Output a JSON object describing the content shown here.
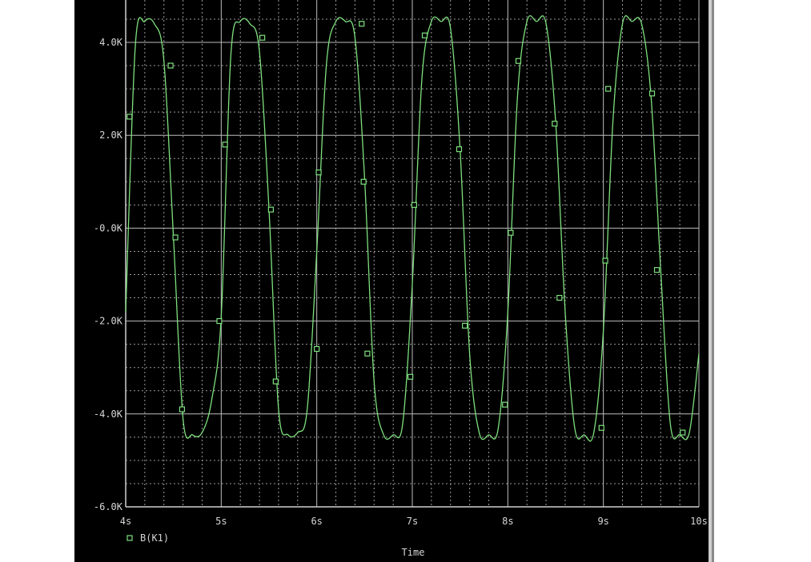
{
  "chart_data": {
    "type": "line",
    "xlabel": "Time",
    "ylabel": "",
    "xlim": [
      4,
      10
    ],
    "ylim": [
      -6000,
      4500
    ],
    "x_ticks": [
      4,
      5,
      6,
      7,
      8,
      9,
      10
    ],
    "x_tick_labels": [
      "4s",
      "5s",
      "6s",
      "7s",
      "8s",
      "9s",
      "10s"
    ],
    "y_ticks": [
      4000,
      2000,
      0,
      -2000,
      -4000,
      -6000
    ],
    "y_tick_labels": [
      "4.0K",
      "2.0K",
      "-0.0K",
      "-2.0K",
      "-4.0K",
      "-6.0K"
    ],
    "grid": true,
    "legend_position": "bottom-left",
    "series": [
      {
        "name": "B(K1)",
        "color": "#7ee07e",
        "marker": "square",
        "x": [
          4.0,
          4.1,
          4.2,
          4.3,
          4.4,
          4.5,
          4.6,
          4.7,
          4.8,
          4.9,
          5.0,
          5.1,
          5.2,
          5.3,
          5.4,
          5.5,
          5.6,
          5.7,
          5.8,
          5.9,
          6.0,
          6.1,
          6.2,
          6.3,
          6.4,
          6.5,
          6.6,
          6.7,
          6.8,
          6.9,
          7.0,
          7.1,
          7.2,
          7.3,
          7.4,
          7.5,
          7.6,
          7.7,
          7.8,
          7.9,
          8.0,
          8.1,
          8.2,
          8.3,
          8.4,
          8.5,
          8.6,
          8.7,
          8.8,
          8.9,
          9.0,
          9.1,
          9.2,
          9.3,
          9.4,
          9.5,
          9.6,
          9.7,
          9.8,
          9.9,
          10.0
        ],
        "y": [
          -1800,
          3900,
          4450,
          4400,
          3600,
          -200,
          -4100,
          -4450,
          -4400,
          -3700,
          -1900,
          3700,
          4450,
          4400,
          3800,
          400,
          -3900,
          -4450,
          -4400,
          -3900,
          -500,
          3500,
          4450,
          4450,
          4100,
          1100,
          -3300,
          -4450,
          -4450,
          -4200,
          -1200,
          3200,
          4450,
          4450,
          4300,
          1700,
          -2700,
          -4400,
          -4450,
          -4300,
          -1800,
          2800,
          4450,
          4450,
          4400,
          2300,
          -1800,
          -4300,
          -4450,
          -4400,
          -2200,
          2300,
          4400,
          4450,
          4400,
          2800,
          -900,
          -4200,
          -4450,
          -4400,
          -2700
        ],
        "marker_x": [
          4.04,
          4.47,
          4.52,
          4.59,
          4.98,
          5.04,
          5.43,
          5.52,
          5.57,
          6.0,
          6.02,
          6.47,
          6.49,
          6.53,
          6.98,
          7.02,
          7.13,
          7.49,
          7.55,
          7.97,
          8.03,
          8.11,
          8.49,
          8.54,
          8.98,
          9.02,
          9.05,
          9.51,
          9.56,
          9.83
        ],
        "marker_y": [
          2400,
          3500,
          -200,
          -3900,
          -2000,
          1800,
          4100,
          400,
          -3300,
          -2600,
          1200,
          4400,
          1000,
          -2700,
          -3200,
          500,
          4150,
          1700,
          -2100,
          -3800,
          -100,
          3600,
          2250,
          -1500,
          -4300,
          -700,
          3000,
          2900,
          -900,
          -4400
        ]
      }
    ]
  }
}
